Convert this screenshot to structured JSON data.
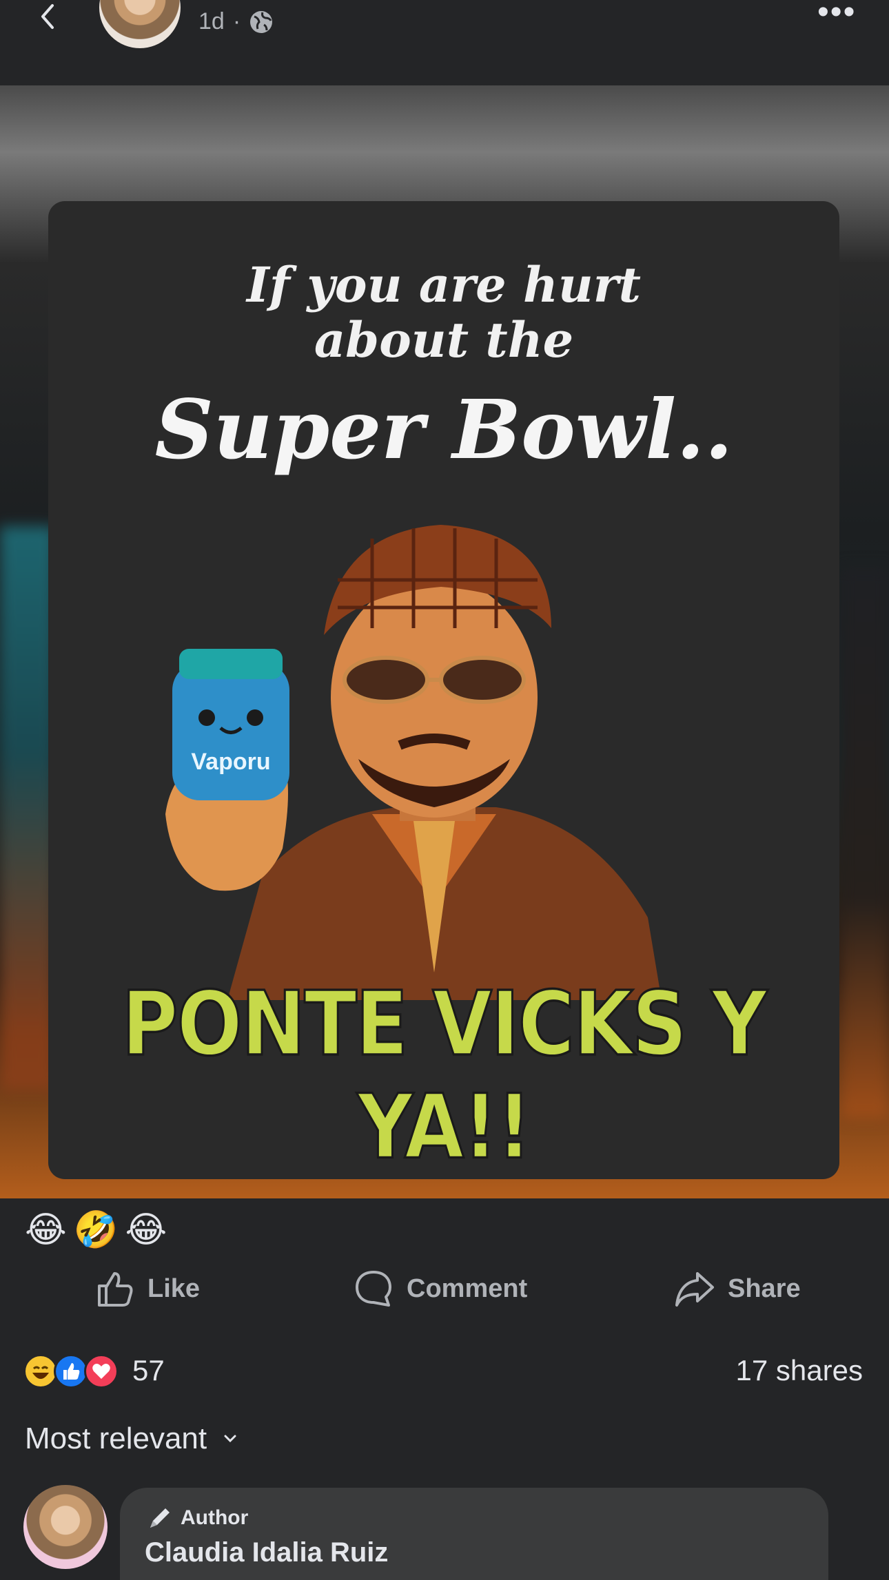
{
  "header": {
    "time": "1d",
    "separator": "·",
    "back_icon": "chevron-left-icon",
    "privacy_icon": "globe-icon",
    "more_label": "•••"
  },
  "post": {
    "image_text": {
      "line1": "If you are hurt about the",
      "line2": "Super Bowl..",
      "jar_label": "Vaporu",
      "bottom": "PONTE VICKS Y YA!!"
    },
    "caption_emojis": [
      "😂",
      "🤣",
      "😂"
    ]
  },
  "actions": {
    "like": "Like",
    "comment": "Comment",
    "share": "Share"
  },
  "summary": {
    "reaction_count": "57",
    "shares": "17 shares",
    "reactions": [
      "haha",
      "like",
      "love"
    ]
  },
  "comments": {
    "sort_label": "Most relevant",
    "first": {
      "badge": "Author",
      "name": "Claudia Idalia Ruiz"
    }
  },
  "colors": {
    "background": "#242527",
    "text": "#e4e6eb",
    "muted": "#b0b3b8",
    "bubble": "#3a3b3c",
    "like_blue": "#1877f2",
    "love_red": "#f33e58",
    "meme_green": "#c6d94a"
  }
}
